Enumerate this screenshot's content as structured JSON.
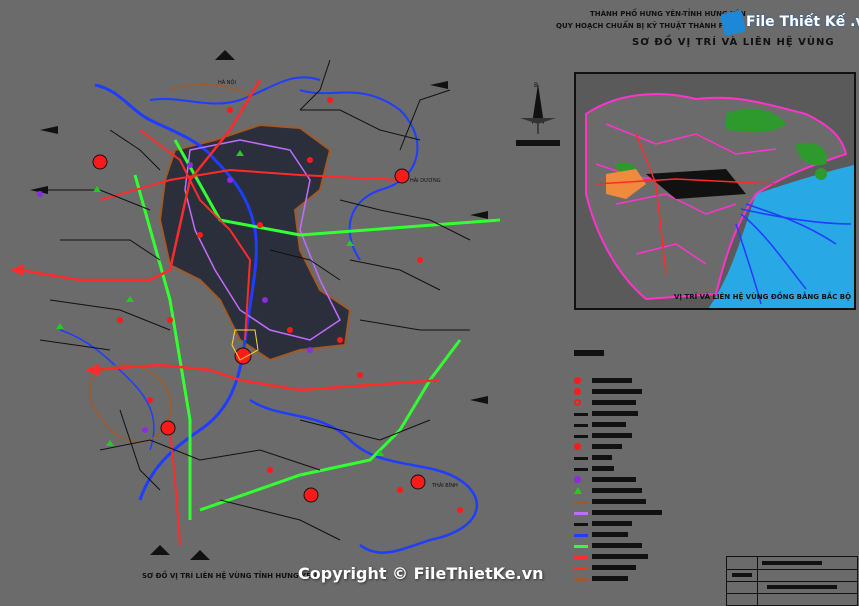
{
  "header": {
    "line1": "THÀNH PHỐ HƯNG YÊN-TỈNH HƯNG YÊN",
    "line2": "QUY HOẠCH CHUẨN BỊ KỸ THUẬT THÀNH PHỐ",
    "line3": "SƠ ĐỒ VỊ TRÍ VÀ LIÊN HỆ VÙNG"
  },
  "brand": {
    "name": "File Thiết Kế .vn"
  },
  "map": {
    "caption": "SƠ ĐỒ VỊ TRÍ LIÊN HỆ VÙNG TỈNH HƯNG YÊN",
    "place_labels": [
      "HÀ NỘI",
      "HẢI DƯƠNG",
      "THÁI BÌNH"
    ],
    "colors": {
      "background": "#6b6b6b",
      "urban_area": "#2b2f3c",
      "expressway": "#33ff33",
      "national_road": "#ff2a2a",
      "river": "#1f3dff",
      "province_boundary": "#c06cff",
      "district_boundary": "#a05a2a",
      "city_marker": "#ff1a1a"
    }
  },
  "inset": {
    "caption": "VỊ TRÍ VÀ LIÊN HỆ VÙNG ĐỒNG BẰNG BẮC BỘ",
    "colors": {
      "sea": "#29a8e6",
      "land": "#5a5a5a",
      "boundary": "#ff33cc",
      "forest": "#2e9a2e"
    }
  },
  "north_arrow": {
    "label": "B"
  },
  "legend": {
    "title": "",
    "items": [
      {
        "symbol": "red-dot-icon",
        "color": "#ff1a1a"
      },
      {
        "symbol": "red-dot-icon",
        "color": "#ff1a1a"
      },
      {
        "symbol": "red-ring-icon",
        "color": "#ff1a1a"
      },
      {
        "symbol": "dark-line-icon",
        "color": "#111111"
      },
      {
        "symbol": "dark-line-icon",
        "color": "#111111"
      },
      {
        "symbol": "dark-line-icon",
        "color": "#111111"
      },
      {
        "symbol": "cross-circle-icon",
        "color": "#ff1a1a"
      },
      {
        "symbol": "train-icon",
        "color": "#111111"
      },
      {
        "symbol": "plane-icon",
        "color": "#111111"
      },
      {
        "symbol": "purple-dot-icon",
        "color": "#8b2be2"
      },
      {
        "symbol": "green-triangle-icon",
        "color": "#22cc22"
      },
      {
        "symbol": "brown-line-icon",
        "color": "#a05a2a"
      },
      {
        "symbol": "purple-line-icon",
        "color": "#c06cff"
      },
      {
        "symbol": "rail-line-icon",
        "color": "#111111"
      },
      {
        "symbol": "blue-line-icon",
        "color": "#1f3dff"
      },
      {
        "symbol": "green-line-icon",
        "color": "#33ff33"
      },
      {
        "symbol": "red-line-icon",
        "color": "#ff2a2a"
      },
      {
        "symbol": "red-line-icon",
        "color": "#ff2a2a"
      },
      {
        "symbol": "brown-line-icon",
        "color": "#a05a2a"
      }
    ]
  },
  "watermark": {
    "text": "Copyright © FileThietKe.vn"
  }
}
